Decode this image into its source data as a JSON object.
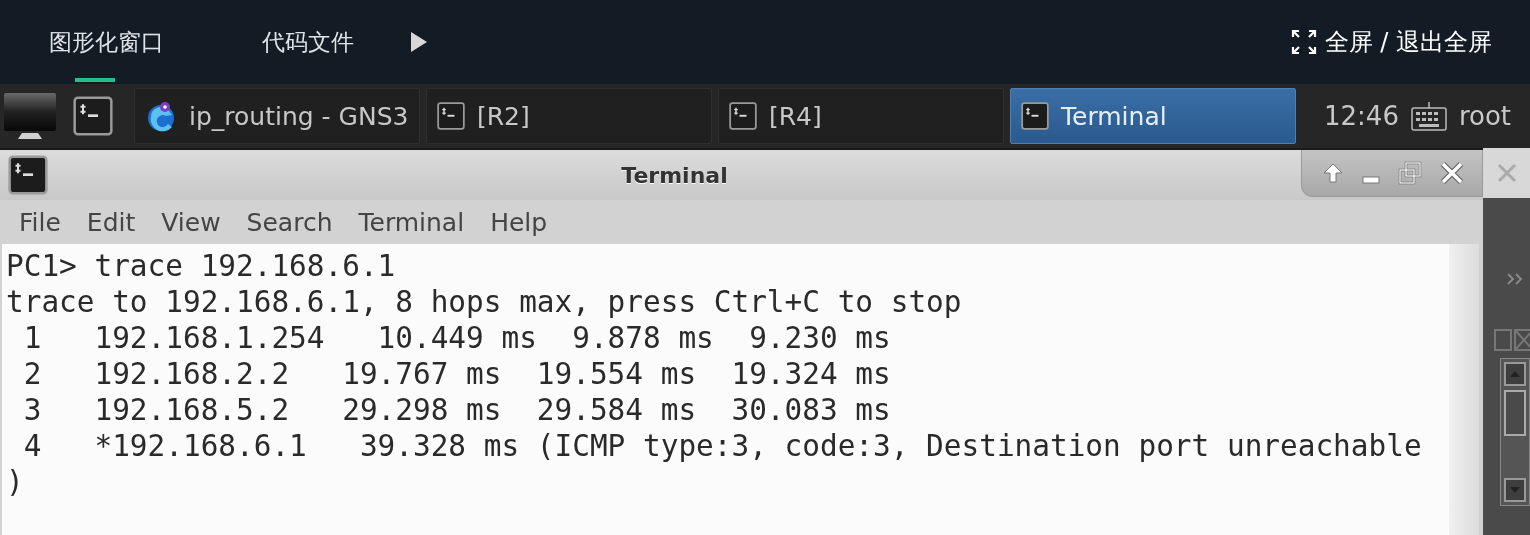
{
  "top_bar": {
    "tabs": [
      {
        "label": "图形化窗口",
        "selected": true
      },
      {
        "label": "代码文件",
        "selected": false
      }
    ],
    "fullscreen": "全屏 / 退出全屏"
  },
  "taskbar": {
    "items": [
      {
        "label": "ip_routing - GNS3",
        "kind": "gns3",
        "selected": false
      },
      {
        "label": "[R2]",
        "kind": "terminal",
        "selected": false
      },
      {
        "label": "[R4]",
        "kind": "terminal",
        "selected": false
      },
      {
        "label": "Terminal",
        "kind": "terminal",
        "selected": true
      }
    ],
    "clock": "12:46",
    "user": "root"
  },
  "window": {
    "title": "Terminal",
    "menu": [
      "File",
      "Edit",
      "View",
      "Search",
      "Terminal",
      "Help"
    ],
    "lines": [
      "PC1> trace 192.168.6.1",
      "trace to 192.168.6.1, 8 hops max, press Ctrl+C to stop",
      " 1   192.168.1.254   10.449 ms  9.878 ms  9.230 ms",
      " 2   192.168.2.2   19.767 ms  19.554 ms  19.324 ms",
      " 3   192.168.5.2   29.298 ms  29.584 ms  30.083 ms",
      " 4   *192.168.6.1   39.328 ms (ICMP type:3, code:3, Destination port unreachable",
      ")"
    ]
  }
}
